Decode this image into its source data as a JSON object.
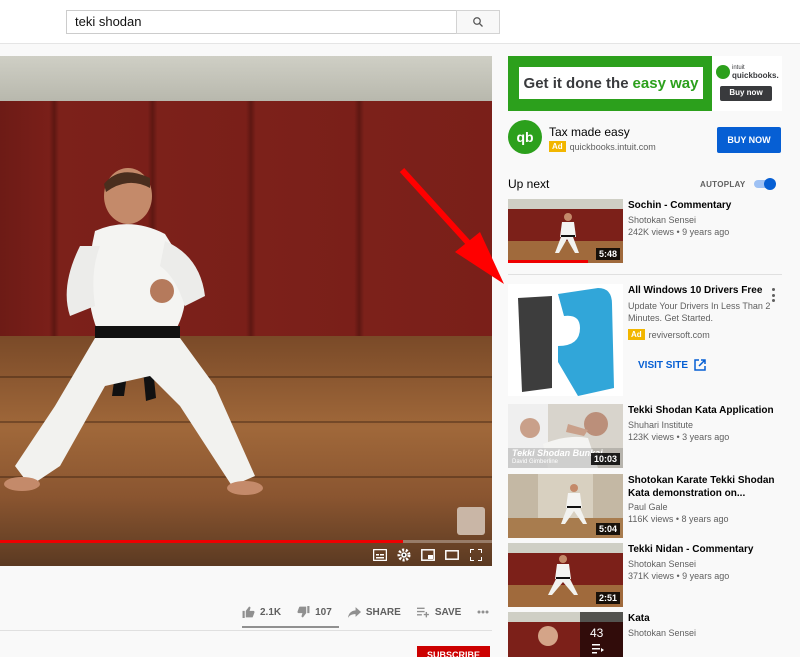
{
  "search": {
    "query": "teki shodan"
  },
  "player": {
    "progress": 0.82
  },
  "actions": {
    "likes": "2.1K",
    "dislikes": "107",
    "share": "SHARE",
    "save": "SAVE"
  },
  "subscribe_label": "SUBSCRIBE",
  "banner_ad": {
    "headline_a": "Get it done the",
    "headline_b": "easy way",
    "brand": "quickbooks.",
    "brand_small": "intuit",
    "cta": "Buy now"
  },
  "ad": {
    "title": "Tax made easy",
    "badge": "Ad",
    "domain": "quickbooks.intuit.com",
    "cta": "BUY NOW",
    "logo_text": "qb"
  },
  "upnext": {
    "label": "Up next",
    "autoplay_label": "AUTOPLAY",
    "autoplay_on": true
  },
  "videos": [
    {
      "title": "Sochin - Commentary",
      "channel": "Shotokan Sensei",
      "views": "242K views • 9 years ago",
      "duration": "5:48"
    },
    {
      "title": "Tekki Shodan Kata Application",
      "channel": "Shuhari Institute",
      "views": "123K views • 3 years ago",
      "duration": "10:03",
      "overlay": "Tekki Shodan Bunkai",
      "overlay_sub": "David Gimberline"
    },
    {
      "title": "Shotokan Karate Tekki Shodan Kata demonstration on...",
      "channel": "Paul Gale",
      "views": "116K views • 8 years ago",
      "duration": "5:04"
    },
    {
      "title": "Tekki Nidan - Commentary",
      "channel": "Shotokan Sensei",
      "views": "371K views • 9 years ago",
      "duration": "2:51"
    },
    {
      "title": "Kata",
      "channel": "Shotokan Sensei",
      "views": "",
      "duration": "43"
    }
  ],
  "ad_card": {
    "title": "All Windows 10 Drivers Free",
    "description": "Update Your Drivers In Less Than 2 Minutes. Get Started.",
    "badge": "Ad",
    "domain": "reviversoft.com",
    "cta": "VISIT SITE"
  },
  "colors": {
    "accent_blue": "#065fd4",
    "ad_yellow": "#f2b600",
    "youtube_red": "#cc0000",
    "qb_green": "#2ca01c",
    "annotation_red": "#ff0000"
  }
}
